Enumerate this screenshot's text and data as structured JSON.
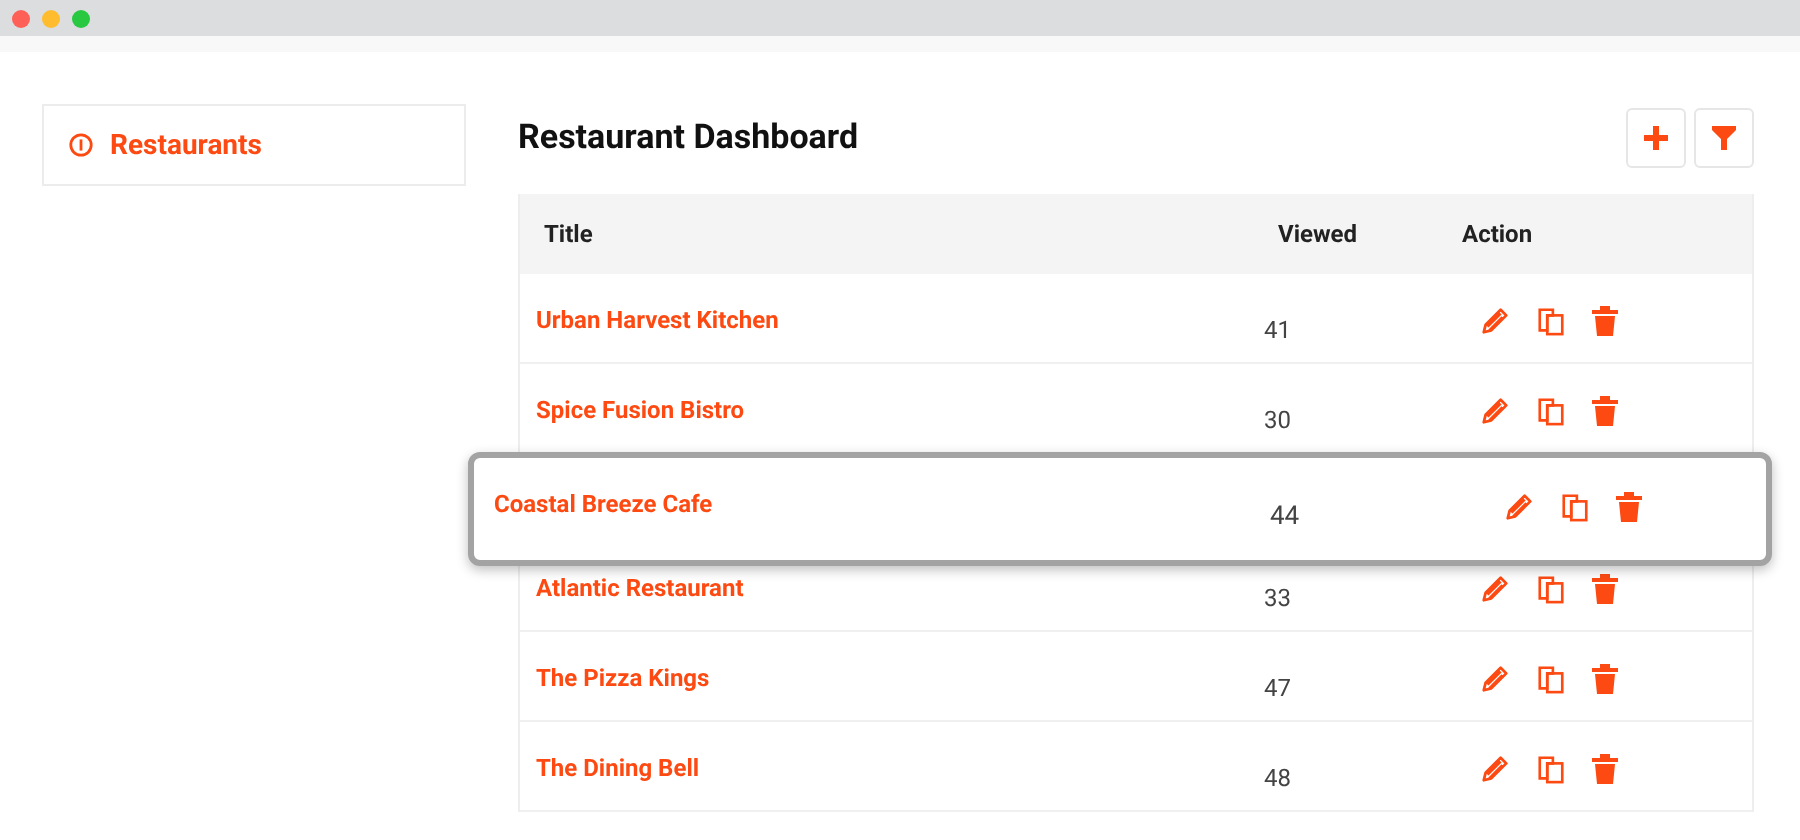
{
  "sidebar": {
    "items": [
      {
        "label": "Restaurants",
        "selected": true
      }
    ]
  },
  "page": {
    "title": "Restaurant Dashboard"
  },
  "table": {
    "columns": [
      "Title",
      "Viewed",
      "Action"
    ],
    "rows": [
      {
        "title": "Urban Harvest Kitchen",
        "viewed": "41",
        "highlighted": false
      },
      {
        "title": "Spice Fusion Bistro",
        "viewed": "30",
        "highlighted": false
      },
      {
        "title": "Coastal Breeze Cafe",
        "viewed": "44",
        "highlighted": true
      },
      {
        "title": "Atlantic Restaurant",
        "viewed": "33",
        "highlighted": false
      },
      {
        "title": "The Pizza Kings",
        "viewed": "47",
        "highlighted": false
      },
      {
        "title": "The Dining Bell",
        "viewed": "48",
        "highlighted": false
      }
    ]
  }
}
